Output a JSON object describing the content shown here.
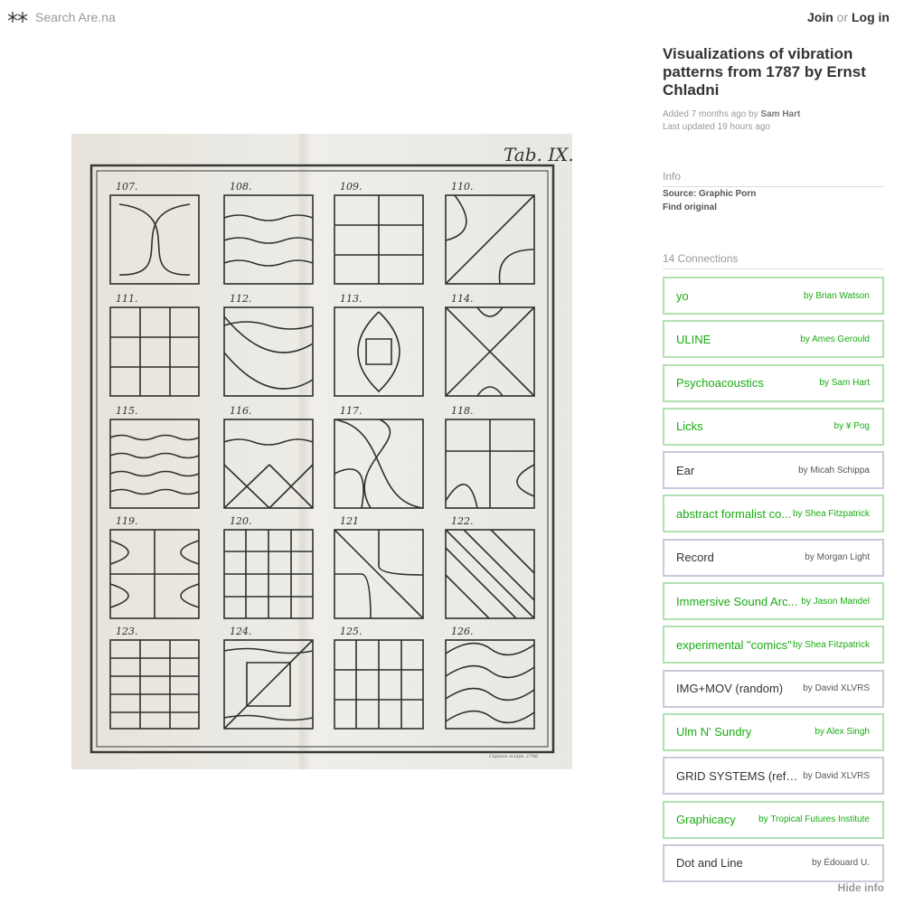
{
  "header": {
    "search_placeholder": "Search Are.na",
    "join_label": "Join",
    "or_label": "or",
    "login_label": "Log in"
  },
  "block": {
    "title": "Visualizations of vibration patterns from 1787 by Ernst Chladni",
    "added_prefix": "Added 7 months ago by",
    "added_user": "Sam Hart",
    "last_updated": "Last updated 19 hours ago"
  },
  "image": {
    "plate_label": "Tab. IX.",
    "engraver": "Capieux sculps. 1786.",
    "figures": [
      "107.",
      "108.",
      "109.",
      "110.",
      "111.",
      "112.",
      "113.",
      "114.",
      "115.",
      "116.",
      "117.",
      "118.",
      "119.",
      "120.",
      "121",
      "122.",
      "123.",
      "124.",
      "125.",
      "126."
    ]
  },
  "info": {
    "label": "Info",
    "source": "Source: Graphic Porn",
    "find_original": "Find original"
  },
  "connections": {
    "label": "14 Connections",
    "items": [
      {
        "title": "yo",
        "by": "by Brian Watson"
      },
      {
        "title": "ULINE",
        "by": "by Ames Gerould"
      },
      {
        "title": "Psychoacoustics",
        "by": "by Sam Hart"
      },
      {
        "title": "Licks",
        "by": "by ¥ Pog"
      },
      {
        "title": "Ear",
        "by": "by Micah Schippa"
      },
      {
        "title": "abstract formalist co...",
        "by": "by Shea Fitzpatrick"
      },
      {
        "title": "Record",
        "by": "by Morgan Light"
      },
      {
        "title": "Immersive Sound Arc...",
        "by": "by Jason Mandel"
      },
      {
        "title": "experimental \"comics\"",
        "by": "by Shea Fitzpatrick"
      },
      {
        "title": "IMG+MOV (random)",
        "by": "by David XLVRS"
      },
      {
        "title": "Ulm N' Sundry",
        "by": "by Alex Singh"
      },
      {
        "title": "GRID SYSTEMS (refe...",
        "by": "by David XLVRS"
      },
      {
        "title": "Graphicacy",
        "by": "by Tropical Futures Institute"
      },
      {
        "title": "Dot and Line",
        "by": "by Édouard U."
      }
    ]
  },
  "footer": {
    "hide_info": "Hide info"
  },
  "colors": {
    "public_channel": "#17ac10",
    "public_border": "#b3e0b3",
    "private_border": "#c9c9dc"
  },
  "icons": {
    "logo": "arena-logo-icon"
  }
}
